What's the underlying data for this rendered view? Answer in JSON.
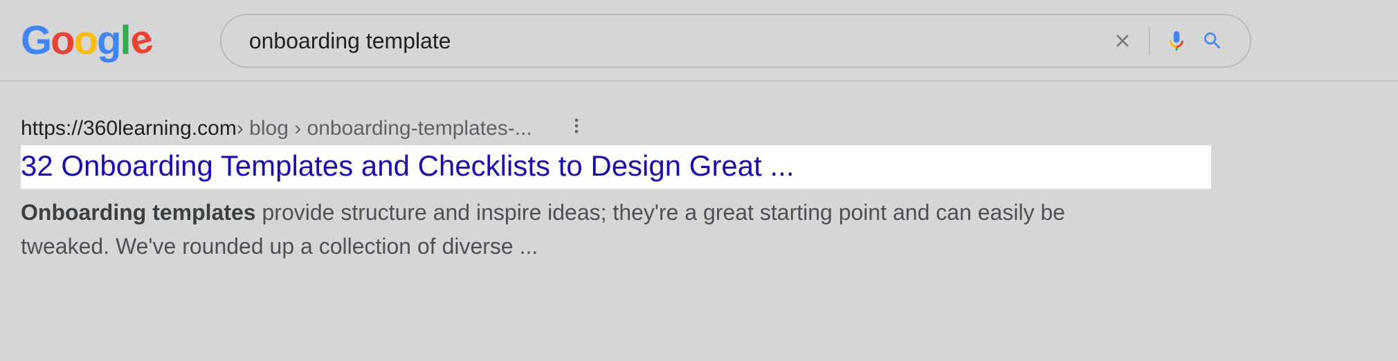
{
  "search": {
    "query": "onboarding template",
    "aria_clear": "Clear",
    "aria_voice": "Search by voice",
    "aria_search": "Search"
  },
  "logo": {
    "g1": "G",
    "g2": "o",
    "g3": "o",
    "g4": "g",
    "g5": "l",
    "g6": "e"
  },
  "result": {
    "url_domain": "https://360learning.com",
    "url_path": " › blog › onboarding-templates-...",
    "title": "32 Onboarding Templates and Checklists to Design Great ...",
    "snippet_bold": "Onboarding templates",
    "snippet_rest": " provide structure and inspire ideas; they're a great starting point and can easily be tweaked. We've rounded up a collection of diverse ..."
  }
}
